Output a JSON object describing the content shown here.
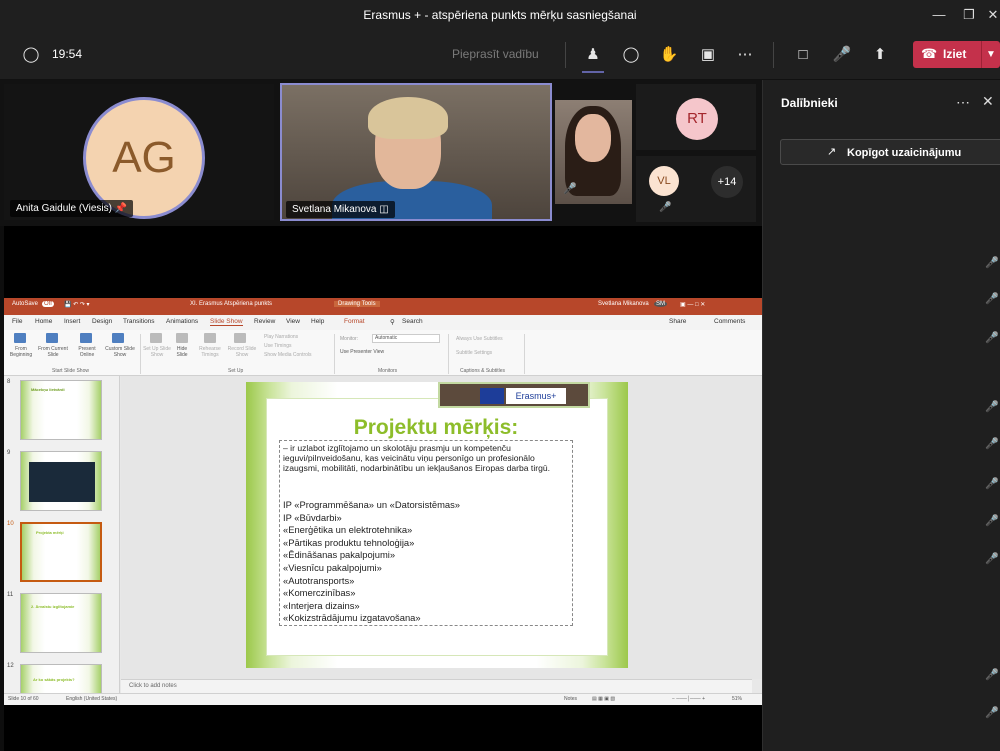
{
  "window": {
    "title": "Erasmus + - atspēriena punkts mērķu sasniegšanai"
  },
  "toolbar": {
    "timer": "19:54",
    "request_control": "Pieprasīt vadību",
    "leave_label": "Iziet"
  },
  "participants_strip": {
    "ag_initials": "AG",
    "ag_name": "Anita Gaidule (Viesis)",
    "presenter_name": "Svetlana Mikanova",
    "rt_initials": "RT",
    "vl_initials": "VL",
    "more_count": "+14"
  },
  "ppt": {
    "autosave": "AutoSave",
    "autosave_state": "Off",
    "file_title": "XI. Erasmus Atspēriena punkts",
    "drawing_tools": "Drawing Tools",
    "user": "Svetlana Mikanova",
    "user_initials": "SM",
    "menu": [
      "File",
      "Home",
      "Insert",
      "Design",
      "Transitions",
      "Animations",
      "Slide Show",
      "Review",
      "View",
      "Help",
      "Format"
    ],
    "search": "Search",
    "share": "Share",
    "comments": "Comments",
    "ribbon": {
      "from_beginning": "From Beginning",
      "from_current": "From Current Slide",
      "present_online": "Present Online",
      "custom_show": "Custom Slide Show",
      "set_up": "Set Up Slide Show",
      "hide_slide": "Hide Slide",
      "rehearse": "Rehearse Timings",
      "record": "Record Slide Show",
      "play_narrations": "Play Narrations",
      "use_timings": "Use Timings",
      "show_media": "Show Media Controls",
      "monitor_label": "Monitor:",
      "monitor_value": "Automatic",
      "presenter_view": "Use Presenter View",
      "always_subtitles": "Always Use Subtitles",
      "subtitle_settings": "Subtitle Settings",
      "group_start": "Start Slide Show",
      "group_setup": "Set Up",
      "group_monitors": "Monitors",
      "group_captions": "Captions & Subtitles"
    },
    "thumb_numbers": [
      "8",
      "9",
      "10",
      "11",
      "12"
    ],
    "thumb_captions": [
      "Mācekņu lietvārdi",
      "",
      "Projekta mērķi",
      "2. Ārvalstu izglītojamie",
      "Ar ko sākās projekts?"
    ],
    "notes_placeholder": "Click to add notes",
    "status_slide": "Slide 10 of 60",
    "status_lang": "English (United States)",
    "status_notes": "Notes",
    "status_zoom": "51%"
  },
  "slide": {
    "badge": "Erasmus+",
    "heading": "Projektu mērķis:",
    "paragraph": "– ir uzlabot izglītojamo  un skolotāju prasmju un kompetenču ieguvi/pilnveidošanu,  kas veicinātu viņu personīgo un profesionālo izaugsmi, mobilitāti, nodarbinātību un iekļaušanos Eiropas darba tirgū.",
    "programs": [
      "IP «Programmēšana» un «Datorsistēmas»",
      "IP «Būvdarbi»",
      "«Enerģētika un elektrotehnika»",
      "«Pārtikas produktu tehnoloģija»",
      "«Ēdināšanas pakalpojumi»",
      "«Viesnīcu pakalpojumi»",
      "«Autotransports»",
      "«Komerczinības»",
      "«Interjera dizains»",
      "«Kokizstrādājumu izgatavošana»"
    ]
  },
  "panel": {
    "title": "Dalībnieki",
    "copy_invite": "Kopīgot uzaicinājumu"
  },
  "colors": {
    "accent": "#6264a7",
    "leave": "#c4314b",
    "ppt_red": "#b7472a",
    "slide_green": "#8dbd2a"
  }
}
